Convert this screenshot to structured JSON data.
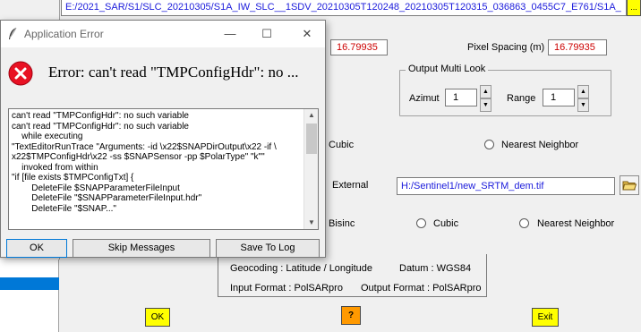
{
  "background": {
    "path": "E:/2021_SAR/S1/SLC_20210305/S1A_IW_SLC__1SDV_20210305T120248_20210305T120315_036863_0455C7_E761/S1A_",
    "path_button": "...",
    "range_spacing_value": "16.79935",
    "pixel_spacing_label": "Pixel Spacing (m)",
    "pixel_spacing_value": "16.79935",
    "multilook": {
      "title": "Output Multi Look",
      "azimut_label": "Azimut",
      "azimut_value": "1",
      "range_label": "Range",
      "range_value": "1"
    },
    "resampling_1": {
      "cubic_label": "Cubic",
      "nearest_label": "Nearest Neighbor"
    },
    "dem": {
      "external_label": "External",
      "path": "H:/Sentinel1/new_SRTM_dem.tif"
    },
    "resampling_2": {
      "bisinc_label": "Bisinc",
      "cubic_label": "Cubic",
      "nearest_label": "Nearest Neighbor"
    },
    "info": {
      "geocoding": "Geocoding : Latitude / Longitude",
      "datum": "Datum : WGS84",
      "input_format": "Input Format : PolSARpro",
      "output_format": "Output Format : PolSARpro"
    },
    "ok_label": "OK",
    "help_label": "?",
    "exit_label": "Exit"
  },
  "dialog": {
    "title": "Application Error",
    "minimize": "—",
    "maximize": "☐",
    "close": "✕",
    "error_message": "Error: can't read \"TMPConfigHdr\": no ...",
    "trace_lines": [
      "can't read \"TMPConfigHdr\": no such variable",
      "can't read \"TMPConfigHdr\": no such variable",
      "    while executing",
      "\"TextEditorRunTrace \"Arguments: -id \\x22$SNAPDirOutput\\x22 -if \\",
      "x22$TMPConfigHdr\\x22 -ss $SNAPSensor -pp $PolarType\" \"k\"\"",
      "    invoked from within",
      "\"if [file exists $TMPConfigTxt] {",
      "        DeleteFile $SNAPParameterFileInput",
      "        DeleteFile \"$SNAPParameterFileInput.hdr\"",
      "        DeleteFile \"$SNAP...\""
    ],
    "ok_label": "OK",
    "skip_label": "Skip Messages",
    "save_label": "Save To Log"
  }
}
